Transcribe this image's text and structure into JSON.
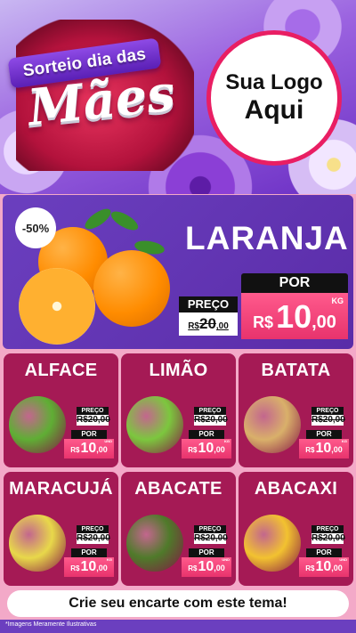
{
  "header": {
    "ribbon": "Sorteio dia das",
    "title": "Mães",
    "logo_line1": "Sua Logo",
    "logo_line2": "Aqui"
  },
  "featured": {
    "badge": "-50%",
    "name": "LARANJA",
    "preco_label": "PREÇO",
    "old_currency": "R$",
    "old_int": "20",
    "old_dec": ",00",
    "por_label": "POR",
    "currency": "R$",
    "price_int": "10",
    "price_dec": ",00",
    "unit": "KG"
  },
  "products": [
    {
      "name": "ALFACE",
      "preco_label": "PREÇO",
      "old": "R$20,00",
      "por_label": "POR",
      "currency": "R$",
      "int": "10",
      "dec": ",00",
      "unit": "UND",
      "color": "#5fae34"
    },
    {
      "name": "LIMÃO",
      "preco_label": "PREÇO",
      "old": "R$20,00",
      "por_label": "POR",
      "currency": "R$",
      "int": "10",
      "dec": ",00",
      "unit": "KG",
      "color": "#7cc73e"
    },
    {
      "name": "BATATA",
      "preco_label": "PREÇO",
      "old": "R$20,00",
      "por_label": "POR",
      "currency": "R$",
      "int": "10",
      "dec": ",00",
      "unit": "KG",
      "color": "#d9b06a"
    },
    {
      "name": "MARACUJÁ",
      "preco_label": "PREÇO",
      "old": "R$20,00",
      "por_label": "POR",
      "currency": "R$",
      "int": "10",
      "dec": ",00",
      "unit": "KG",
      "color": "#e8d84a"
    },
    {
      "name": "ABACATE",
      "preco_label": "PREÇO",
      "old": "R$20,00",
      "por_label": "POR",
      "currency": "R$",
      "int": "10",
      "dec": ",00",
      "unit": "UND",
      "color": "#4f7a2a"
    },
    {
      "name": "ABACAXI",
      "preco_label": "PREÇO",
      "old": "R$20,00",
      "por_label": "POR",
      "currency": "R$",
      "int": "10",
      "dec": ",00",
      "unit": "UND",
      "color": "#f2c230"
    }
  ],
  "cta": "Crie seu encarte com este tema!",
  "disclaimer": "*Imagens Meramente Ilustrativas"
}
